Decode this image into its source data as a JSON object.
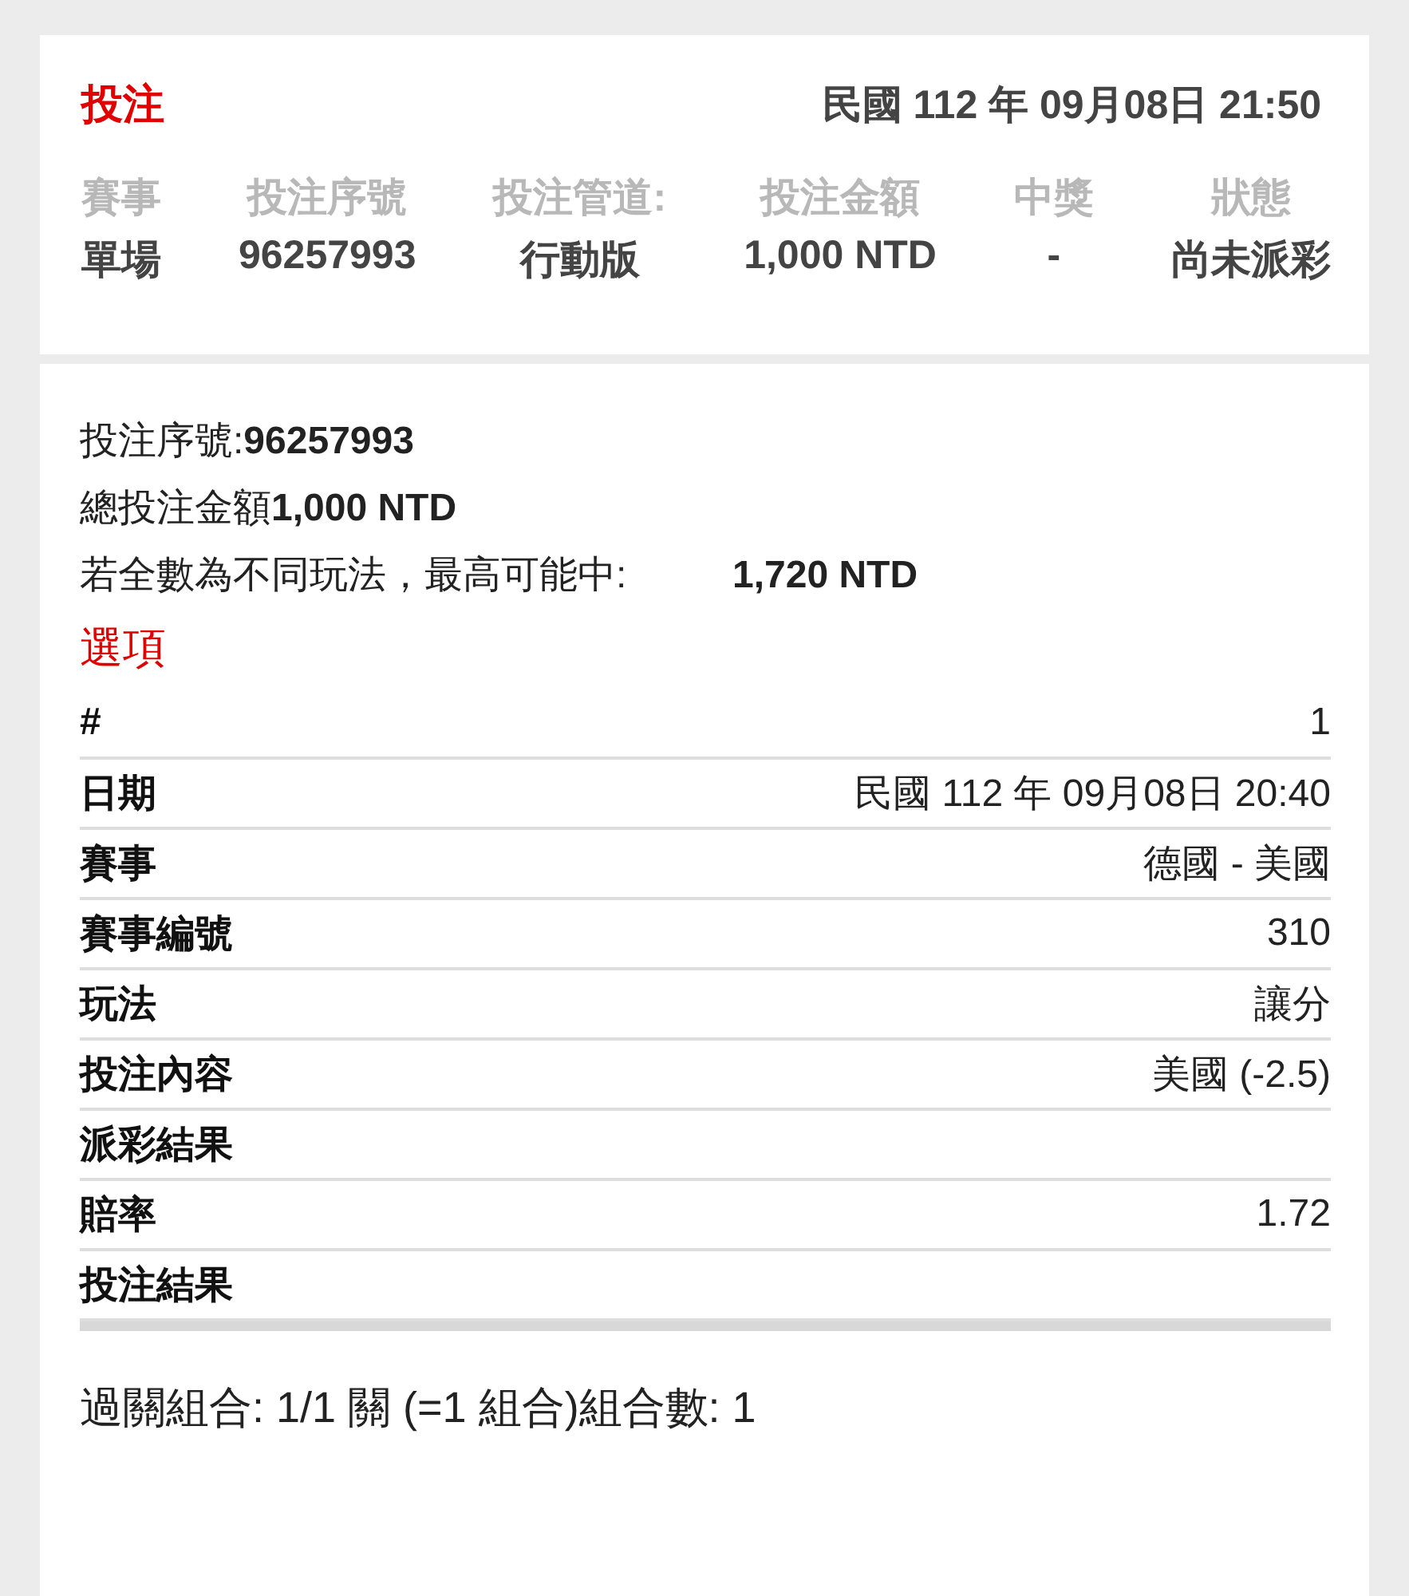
{
  "summary": {
    "title": "投注",
    "datetime": "民國 112 年 09月08日 21:50",
    "columns": [
      {
        "label": "賽事",
        "value": "單場"
      },
      {
        "label": "投注序號",
        "value": "96257993"
      },
      {
        "label": "投注管道:",
        "value": "行動版"
      },
      {
        "label": "投注金額",
        "value": "1,000 NTD"
      },
      {
        "label": "中獎",
        "value": "-"
      },
      {
        "label": "狀態",
        "value": "尚未派彩"
      }
    ]
  },
  "details": {
    "serial_label": "投注序號:",
    "serial": "96257993",
    "total_label": "總投注金額",
    "total": "1,000 NTD",
    "max_label": "若全數為不同玩法，最高可能中:",
    "max": "1,720 NTD",
    "section_title": "選項",
    "rows": [
      {
        "label": "#",
        "value": "1"
      },
      {
        "label": "日期",
        "value": "民國 112 年 09月08日 20:40"
      },
      {
        "label": "賽事",
        "value": "德國 - 美國"
      },
      {
        "label": "賽事編號",
        "value": "310"
      },
      {
        "label": "玩法",
        "value": "讓分"
      },
      {
        "label": "投注內容",
        "value": "美國 (-2.5)"
      },
      {
        "label": "派彩結果",
        "value": ""
      },
      {
        "label": "賠率",
        "value": "1.72"
      },
      {
        "label": "投注結果",
        "value": ""
      }
    ],
    "combination": "過關組合: 1/1 關 (=1 組合)組合數: 1"
  }
}
